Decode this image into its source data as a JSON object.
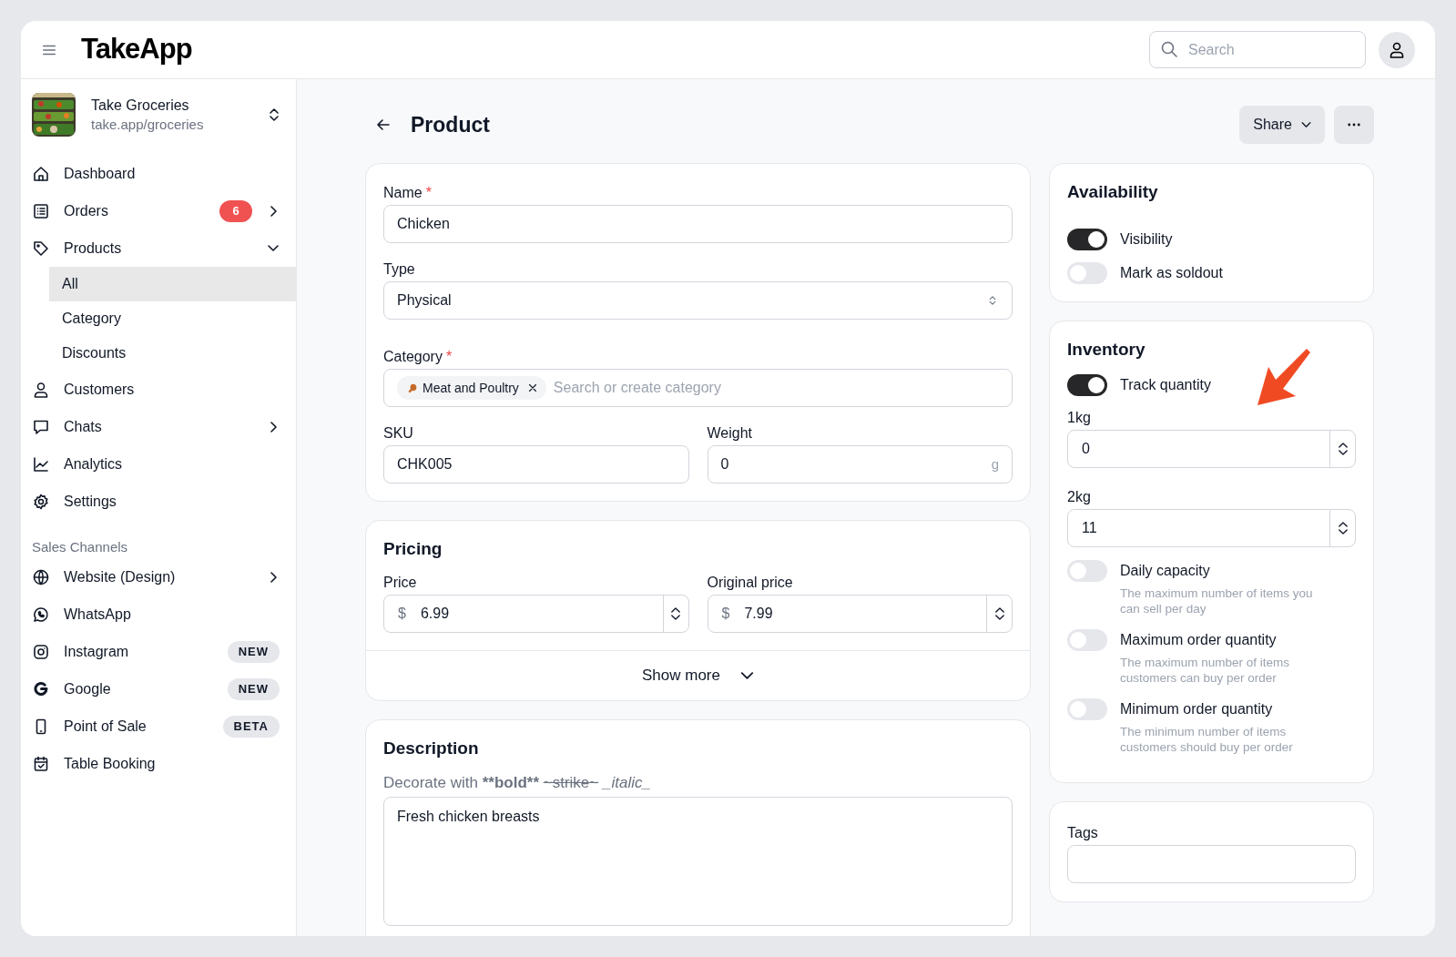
{
  "header": {
    "logo": "TakeApp",
    "search": {
      "placeholder": "Search"
    }
  },
  "store": {
    "name": "Take Groceries",
    "url": "take.app/groceries"
  },
  "nav": [
    {
      "label": "Dashboard"
    },
    {
      "label": "Orders",
      "badge": "6",
      "expanded": false
    },
    {
      "label": "Products",
      "expanded": true,
      "children": [
        {
          "label": "All",
          "selected": true
        },
        {
          "label": "Category",
          "selected": false
        },
        {
          "label": "Discounts",
          "selected": false
        }
      ]
    },
    {
      "label": "Customers"
    },
    {
      "label": "Chats",
      "expanded": false
    },
    {
      "label": "Analytics"
    },
    {
      "label": "Settings"
    }
  ],
  "channels_heading": "Sales Channels",
  "channels": [
    {
      "label": "Website (Design)",
      "expanded": false
    },
    {
      "label": "WhatsApp"
    },
    {
      "label": "Instagram",
      "tag": "NEW"
    },
    {
      "label": "Google",
      "tag": "NEW"
    },
    {
      "label": "Point of Sale",
      "tag": "BETA"
    },
    {
      "label": "Table Booking"
    }
  ],
  "page": {
    "title": "Product",
    "share": "Share"
  },
  "details": {
    "name": {
      "label": "Name",
      "required_mark": "*",
      "value": "Chicken"
    },
    "type": {
      "label": "Type",
      "value": "Physical"
    },
    "category": {
      "label": "Category",
      "required_mark": "*",
      "chips": [
        {
          "label": "Meat and Poultry"
        }
      ],
      "placeholder": "Search or create category"
    },
    "sku": {
      "label": "SKU",
      "value": "CHK005"
    },
    "weight": {
      "label": "Weight",
      "value": "0",
      "unit": "g"
    }
  },
  "pricing": {
    "title": "Pricing",
    "fields": [
      {
        "label": "Price",
        "currency": "$",
        "value": "6.99"
      },
      {
        "label": "Original price",
        "currency": "$",
        "value": "7.99"
      }
    ],
    "show_more": "Show more"
  },
  "description": {
    "title": "Description",
    "hint": [
      {
        "text": "Decorate with",
        "kind": "plain"
      },
      {
        "text": "**bold**",
        "kind": "bold"
      },
      {
        "text": "~strike~",
        "kind": "strike"
      },
      {
        "text": "_italic_",
        "kind": "italic"
      }
    ],
    "value": "Fresh chicken breasts"
  },
  "availability": {
    "title": "Availability",
    "toggles": [
      {
        "label": "Visibility",
        "on": true
      },
      {
        "label": "Mark as soldout",
        "on": false
      }
    ]
  },
  "inventory": {
    "title": "Inventory",
    "track": {
      "label": "Track quantity",
      "on": true
    },
    "variants": [
      {
        "label": "1kg",
        "value": "0"
      },
      {
        "label": "2kg",
        "value": "11"
      }
    ],
    "limits": [
      {
        "label": "Daily capacity",
        "on": false,
        "help": "The maximum number of items you can sell per day"
      },
      {
        "label": "Maximum order quantity",
        "on": false,
        "help": "The maximum number of items customers can buy per order"
      },
      {
        "label": "Minimum order quantity",
        "on": false,
        "help": "The minimum number of items customers should buy per order"
      }
    ]
  },
  "tags": {
    "label": "Tags"
  }
}
